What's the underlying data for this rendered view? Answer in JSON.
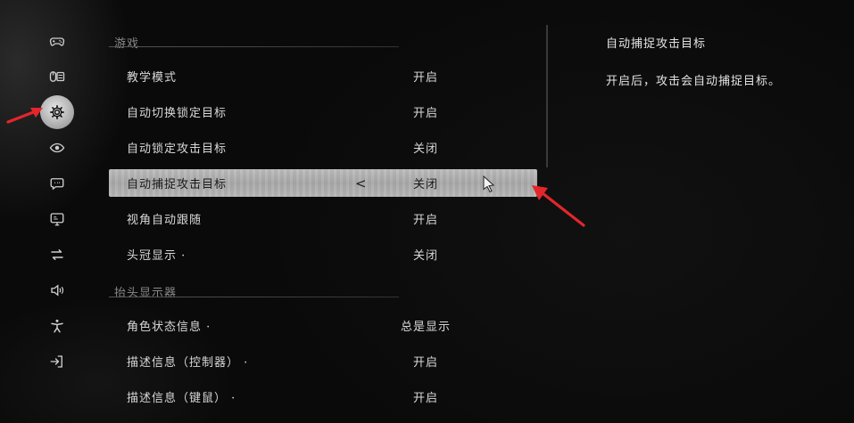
{
  "sidebar": {
    "items": [
      {
        "name": "gamepad-icon",
        "active": false
      },
      {
        "name": "mouse-keyboard-icon",
        "active": false
      },
      {
        "name": "gear-icon",
        "active": true
      },
      {
        "name": "eye-icon",
        "active": false
      },
      {
        "name": "chat-bubble-icon",
        "active": false
      },
      {
        "name": "monitor-icon",
        "active": false
      },
      {
        "name": "swap-arrows-icon",
        "active": false
      },
      {
        "name": "speaker-icon",
        "active": false
      },
      {
        "name": "accessibility-icon",
        "active": false
      },
      {
        "name": "exit-icon",
        "active": false
      }
    ]
  },
  "sections": [
    {
      "title": "游戏",
      "rows": [
        {
          "label": "教学模式",
          "value": "开启"
        },
        {
          "label": "自动切换锁定目标",
          "value": "开启"
        },
        {
          "label": "自动锁定攻击目标",
          "value": "关闭"
        },
        {
          "label": "自动捕捉攻击目标",
          "value": "关闭"
        },
        {
          "label": "视角自动跟随",
          "value": "开启"
        },
        {
          "label": "头冠显示 ·",
          "value": "关闭"
        }
      ]
    },
    {
      "title": "抬头显示器",
      "rows": [
        {
          "label": "角色状态信息 ·",
          "value": "总是显示"
        },
        {
          "label": "描述信息（控制器） ·",
          "value": "开启"
        },
        {
          "label": "描述信息（键鼠） ·",
          "value": "开启"
        }
      ]
    }
  ],
  "selected_row": {
    "chevron": "<"
  },
  "detail": {
    "title": "自动捕捉攻击目标",
    "description": "开启后，攻击会自动捕捉目标。"
  },
  "colors": {
    "accent_annotation": "#e3262b",
    "selected_bg": "#b3b3b3",
    "text": "#d8d8d8",
    "section_header": "#8a8a8a"
  }
}
